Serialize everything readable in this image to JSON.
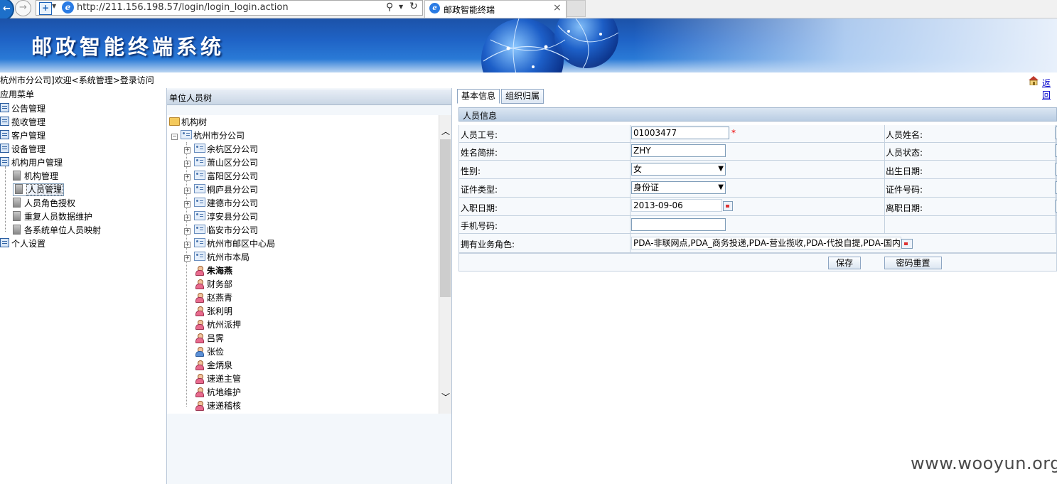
{
  "browser": {
    "url": "http://211.156.198.57/login/login_login.action",
    "tab_title": "邮政智能终端"
  },
  "banner": {
    "title": "邮政智能终端系统"
  },
  "welcome": "杭州市分公司]欢迎<系统管理>登录访问",
  "back_link": "返回",
  "menu": {
    "header": "应用菜单",
    "items": [
      {
        "label": "公告管理"
      },
      {
        "label": "揽收管理"
      },
      {
        "label": "客户管理"
      },
      {
        "label": "设备管理"
      },
      {
        "label": "机构用户管理"
      },
      {
        "label": "机构管理"
      },
      {
        "label": "人员管理"
      },
      {
        "label": "人员角色授权"
      },
      {
        "label": "重复人员数据维护"
      },
      {
        "label": "各系统单位人员映射"
      },
      {
        "label": "个人设置"
      }
    ]
  },
  "tree": {
    "panel_title": "单位人员树",
    "root": "机构树",
    "company": "杭州市分公司",
    "branches": [
      "余杭区分公司",
      "萧山区分公司",
      "富阳区分公司",
      "桐庐县分公司",
      "建德市分公司",
      "淳安县分公司",
      "临安市分公司",
      "杭州市邮区中心局",
      "杭州市本局"
    ],
    "people": [
      "朱海燕",
      "财务部",
      "赵燕青",
      "张利明",
      "杭州派押",
      "吕霁",
      "张俭",
      "金炳泉",
      "速递主管",
      "杭地维护",
      "速递稽核"
    ]
  },
  "form": {
    "tabs": [
      "基本信息",
      "组织归属"
    ],
    "section_title": "人员信息",
    "fields": {
      "emp_no_label": "人员工号:",
      "emp_no": "01003477",
      "pinyin_label": "姓名简拼:",
      "pinyin": "ZHY",
      "gender_label": "性别:",
      "gender": "女",
      "idtype_label": "证件类型:",
      "idtype": "身份证",
      "hire_label": "入职日期:",
      "hire": "2013-09-06",
      "mobile_label": "手机号码:",
      "mobile": "",
      "roles_label": "拥有业务角色:",
      "roles": "PDA-非联网点,PDA_商务投递,PDA-营业揽收,PDA-代投自提,PDA-国内小",
      "name_label": "人员姓名:",
      "status_label": "人员状态:",
      "birth_label": "出生日期:",
      "idno_label": "证件号码:",
      "leave_label": "离职日期:"
    },
    "buttons": {
      "save": "保存",
      "reset_password": "密码重置"
    }
  },
  "watermark": "www.wooyun.org"
}
